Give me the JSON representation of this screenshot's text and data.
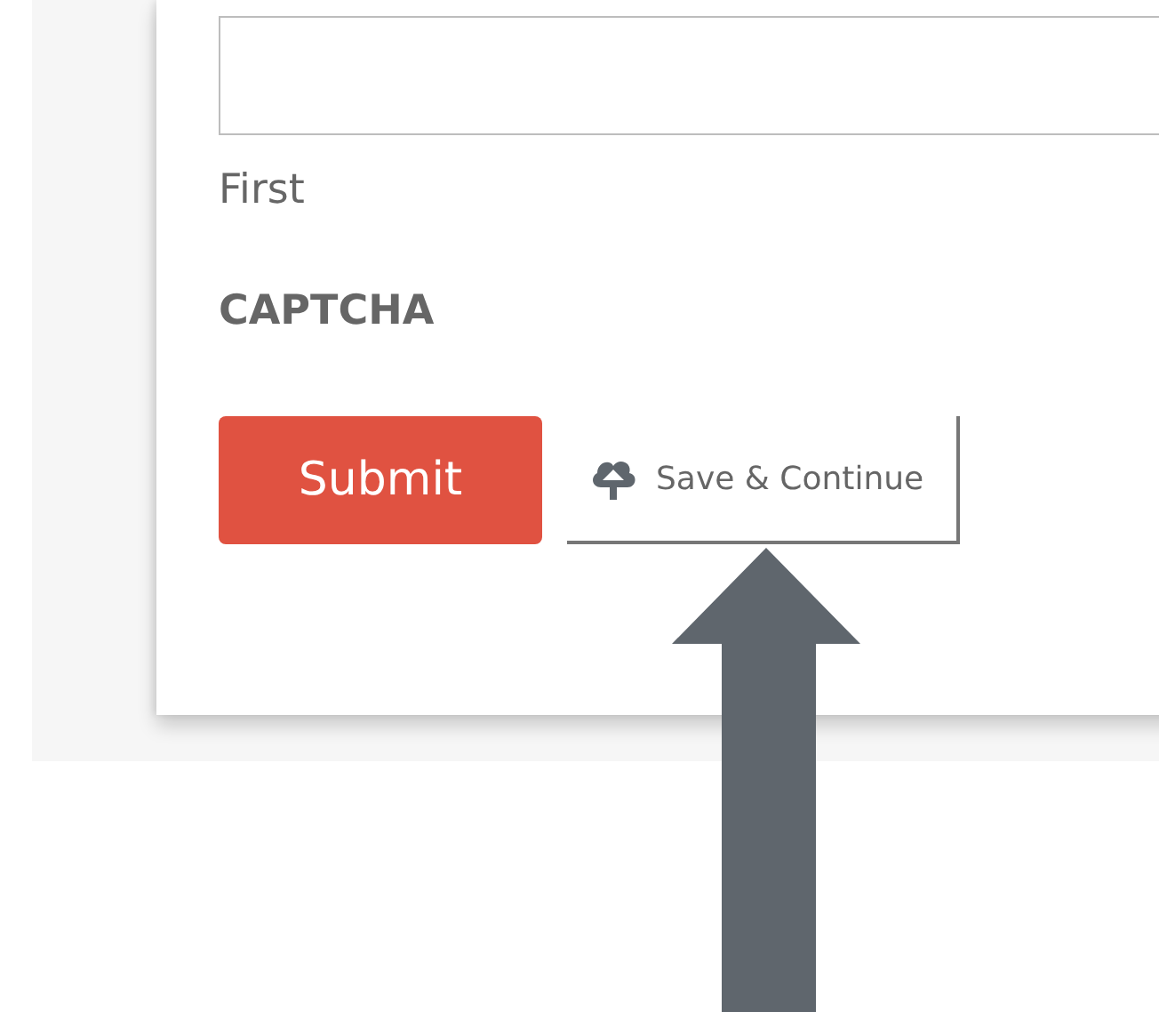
{
  "name_field": {
    "sublabel": "First"
  },
  "captcha": {
    "label": "CAPTCHA"
  },
  "buttons": [
    {
      "kind": "primary",
      "label": "Submit"
    },
    {
      "kind": "save",
      "label": "Save & Continue"
    }
  ]
}
